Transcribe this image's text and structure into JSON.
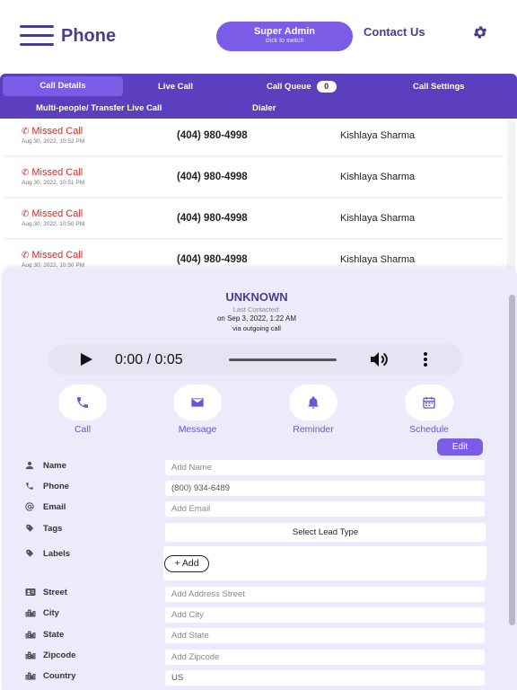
{
  "header": {
    "app_title": "Phone",
    "admin_button": "Super Admin",
    "admin_subtext": "click to switch",
    "contact_link": "Contact Us",
    "icons": [
      "menu-icon",
      "gear-icon"
    ]
  },
  "tabs": {
    "call_details": "Call Details",
    "live_call": "Live Call",
    "call_queue": "Call Queue",
    "call_queue_count": "0",
    "call_settings": "Call Settings",
    "multi_people": "Multi-people/ Transfer Live Call",
    "dialer": "Dialer"
  },
  "calls": [
    {
      "status": "Missed Call",
      "time": "Aug 30, 2022, 10:52 PM",
      "number": "(404) 980-4998",
      "name": "Kishlaya Sharma"
    },
    {
      "status": "Missed Call",
      "time": "Aug 30, 2022, 10:51 PM",
      "number": "(404) 980-4998",
      "name": "Kishlaya Sharma"
    },
    {
      "status": "Missed Call",
      "time": "Aug 30, 2022, 10:50 PM",
      "number": "(404) 980-4998",
      "name": "Kishlaya Sharma"
    },
    {
      "status": "Missed Call",
      "time": "Aug 30, 2022, 10:50 PM",
      "number": "(404) 980-4998",
      "name": "Kishlaya Sharma"
    }
  ],
  "detail": {
    "contact_name": "UNKNOWN",
    "last_contacted_label": "Last Contacted:",
    "last_contacted_date": "on Sep 3, 2022, 1:22 AM",
    "last_contacted_via": "via outgoing call",
    "player_time": "0:00 / 0:05",
    "player_progress": 0,
    "actions": {
      "call": "Call",
      "message": "Message",
      "reminder": "Reminder",
      "schedule": "Schedule"
    },
    "edit_button": "Edit",
    "fields": {
      "name_label": "Name",
      "name_placeholder": "Add Name",
      "phone_label": "Phone",
      "phone_value": "(800) 934-6489",
      "email_label": "Email",
      "email_placeholder": "Add Email",
      "tags_label": "Tags",
      "lead_type": "Select Lead Type",
      "labels_label": "Labels",
      "add_button": "+ Add",
      "street_label": "Street",
      "street_placeholder": "Add Address Street",
      "city_label": "City",
      "city_placeholder": "Add City",
      "state_label": "State",
      "state_placeholder": "Add State",
      "zipcode_label": "Zipcode",
      "zipcode_placeholder": "Add Zipcode",
      "country_label": "Country",
      "country_value": "US"
    }
  },
  "colors": {
    "brand": "#4a3d8f",
    "accent": "#7b5ce6",
    "tab_bar": "#5b3fbf",
    "missed": "#e02424",
    "panel": "#ecebfb"
  }
}
